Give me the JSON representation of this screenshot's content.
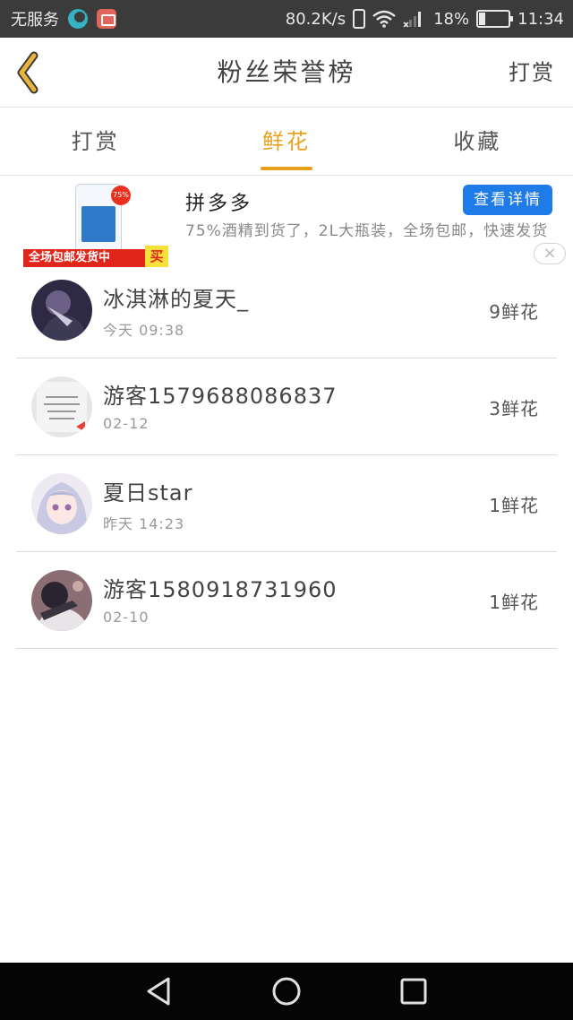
{
  "status_bar": {
    "carrier": "无服务",
    "speed": "80.2K/s",
    "battery": "18%",
    "time": "11:34",
    "icons": [
      "moon-icon",
      "mail-icon",
      "vibrate-icon",
      "wifi-icon",
      "signal-icon",
      "battery-icon"
    ]
  },
  "header": {
    "title": "粉丝荣誉榜",
    "right_action": "打赏",
    "back_icon": "chevron-left-icon",
    "accent_color": "#e8a11c"
  },
  "tabs": [
    {
      "label": "打赏",
      "active": false
    },
    {
      "label": "鲜花",
      "active": true
    },
    {
      "label": "收藏",
      "active": false
    }
  ],
  "ad": {
    "name": "拼多多",
    "description": "75%酒精到货了，2L大瓶装，全场包邮，快速发货",
    "button": "查看详情",
    "banner_text": "全场包邮发货中",
    "banner_buy": "买",
    "badge": "75%",
    "close": "×"
  },
  "list": [
    {
      "name": "冰淇淋的夏天_",
      "time": "今天 09:38",
      "count": "9鲜花"
    },
    {
      "name": "游客1579688086837",
      "time": "02-12",
      "count": "3鲜花"
    },
    {
      "name": "夏日star",
      "time": "昨天 14:23",
      "count": "1鲜花"
    },
    {
      "name": "游客1580918731960",
      "time": "02-10",
      "count": "1鲜花"
    }
  ],
  "nav_bar": {
    "icons": [
      "back-triangle-icon",
      "home-circle-icon",
      "recents-square-icon"
    ]
  }
}
